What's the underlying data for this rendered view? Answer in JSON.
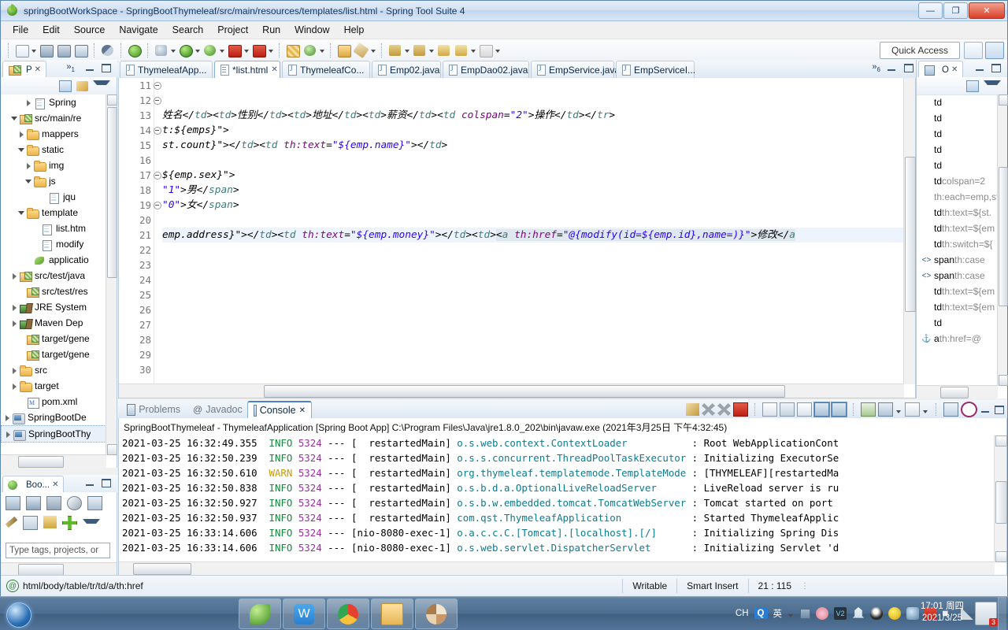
{
  "window": {
    "title": "springBootWorkSpace - SpringBootThymeleaf/src/main/resources/templates/list.html - Spring Tool Suite 4",
    "minimize": "—",
    "maximize": "❐",
    "close": "✕"
  },
  "menubar": [
    "File",
    "Edit",
    "Source",
    "Navigate",
    "Search",
    "Project",
    "Run",
    "Window",
    "Help"
  ],
  "toolbar": {
    "quick_access": "Quick Access"
  },
  "package_explorer": {
    "tab_label": "P",
    "tab_close": "✕",
    "chevron": "»",
    "chevron_count": "1",
    "items": [
      {
        "label": "Spring",
        "indent": 3,
        "arrow": "closed",
        "icon": "jar-icon"
      },
      {
        "label": "src/main/re",
        "indent": 1,
        "arrow": "open",
        "icon": "package-icon"
      },
      {
        "label": "mappers",
        "indent": 2,
        "arrow": "closed",
        "icon": "folder-icon"
      },
      {
        "label": "static",
        "indent": 2,
        "arrow": "open",
        "icon": "folder-icon"
      },
      {
        "label": "img",
        "indent": 3,
        "arrow": "closed",
        "icon": "folder-icon"
      },
      {
        "label": "js",
        "indent": 3,
        "arrow": "open",
        "icon": "folder-icon"
      },
      {
        "label": "jqu",
        "indent": 5,
        "arrow": "none",
        "icon": "js-file-icon"
      },
      {
        "label": "template",
        "indent": 2,
        "arrow": "open",
        "icon": "folder-icon"
      },
      {
        "label": "list.htm",
        "indent": 4,
        "arrow": "none",
        "icon": "html-file-icon"
      },
      {
        "label": "modify",
        "indent": 4,
        "arrow": "none",
        "icon": "html-file-icon"
      },
      {
        "label": "applicatio",
        "indent": 3,
        "arrow": "none",
        "icon": "leaf-icon"
      },
      {
        "label": "src/test/java",
        "indent": 1,
        "arrow": "closed",
        "icon": "package-icon"
      },
      {
        "label": "src/test/res",
        "indent": 2,
        "arrow": "none",
        "icon": "package-icon"
      },
      {
        "label": "JRE System",
        "indent": 1,
        "arrow": "closed",
        "icon": "library-icon"
      },
      {
        "label": "Maven Dep",
        "indent": 1,
        "arrow": "closed",
        "icon": "library-icon"
      },
      {
        "label": "target/gene",
        "indent": 2,
        "arrow": "none",
        "icon": "package-icon"
      },
      {
        "label": "target/gene",
        "indent": 2,
        "arrow": "none",
        "icon": "package-icon"
      },
      {
        "label": "src",
        "indent": 1,
        "arrow": "closed",
        "icon": "folder-icon"
      },
      {
        "label": "target",
        "indent": 1,
        "arrow": "closed",
        "icon": "folder-icon"
      },
      {
        "label": "pom.xml",
        "indent": 2,
        "arrow": "none",
        "icon": "maven-file-icon"
      },
      {
        "label": "SpringBootDe",
        "indent": 0,
        "arrow": "closed",
        "icon": "project-icon"
      },
      {
        "label": "SpringBootThy",
        "indent": 0,
        "arrow": "closed",
        "icon": "project-icon"
      }
    ]
  },
  "boot_dashboard": {
    "tab_label": "Boo...",
    "tab_close": "✕",
    "search_placeholder": "Type tags, projects, or"
  },
  "editor": {
    "tabs": [
      {
        "label": "ThymeleafApp...",
        "icon": "java-file-icon",
        "selected": false,
        "dirty": false
      },
      {
        "label": "*list.html",
        "icon": "html-file-icon",
        "selected": true,
        "dirty": true,
        "close": "✕"
      },
      {
        "label": "ThymeleafCo...",
        "icon": "java-file-icon",
        "selected": false,
        "dirty": false
      },
      {
        "label": "Emp02.java",
        "icon": "java-file-icon",
        "selected": false,
        "dirty": false
      },
      {
        "label": "EmpDao02.java",
        "icon": "java-file-icon",
        "selected": false,
        "dirty": false
      },
      {
        "label": "EmpService.java",
        "icon": "java-file-icon",
        "selected": false,
        "dirty": false
      },
      {
        "label": "EmpServiceI...",
        "icon": "java-file-icon",
        "selected": false,
        "dirty": false
      }
    ],
    "overflow_chevron": "»",
    "overflow_count": "6",
    "lines": [
      {
        "num": "11",
        "fold": true,
        "text": "",
        "current": false
      },
      {
        "num": "12",
        "fold": true,
        "text": "",
        "current": false
      },
      {
        "num": "13",
        "fold": false,
        "text": "姓名</td><td>性别</td><td>地址</td><td>薪资</td><td colspan=\"2\">操作</td></tr>",
        "current": false
      },
      {
        "num": "14",
        "fold": true,
        "text": "t:${emps}\">",
        "current": false
      },
      {
        "num": "15",
        "fold": false,
        "text": "st.count}\"></td><td th:text=\"${emp.name}\"></td>",
        "current": false
      },
      {
        "num": "16",
        "fold": false,
        "text": "",
        "current": false
      },
      {
        "num": "17",
        "fold": true,
        "text": "${emp.sex}\">",
        "current": false
      },
      {
        "num": "18",
        "fold": false,
        "text": "\"1\">男</span>",
        "current": false
      },
      {
        "num": "19",
        "fold": true,
        "text": "\"0\">女</span>",
        "current": false
      },
      {
        "num": "20",
        "fold": false,
        "text": "",
        "current": false
      },
      {
        "num": "21",
        "fold": false,
        "text": "emp.address}\"></td><td th:text=\"${emp.money}\"></td><td><a th:href=\"@{modify(id=${emp.id},name=)}\">修改</a",
        "current": true
      },
      {
        "num": "22",
        "fold": false,
        "text": "",
        "current": false
      },
      {
        "num": "23",
        "fold": false,
        "text": "",
        "current": false
      },
      {
        "num": "24",
        "fold": false,
        "text": "",
        "current": false
      },
      {
        "num": "25",
        "fold": false,
        "text": "",
        "current": false
      },
      {
        "num": "26",
        "fold": false,
        "text": "",
        "current": false
      },
      {
        "num": "27",
        "fold": false,
        "text": "",
        "current": false
      },
      {
        "num": "28",
        "fold": false,
        "text": "",
        "current": false
      },
      {
        "num": "29",
        "fold": false,
        "text": "",
        "current": false
      },
      {
        "num": "30",
        "fold": false,
        "text": "",
        "current": false
      }
    ]
  },
  "outline": {
    "tab_label": "O",
    "tab_close": "✕",
    "items": [
      {
        "element": "td",
        "attr": ""
      },
      {
        "element": "td",
        "attr": ""
      },
      {
        "element": "td",
        "attr": ""
      },
      {
        "element": "td",
        "attr": ""
      },
      {
        "element": "td",
        "attr": ""
      },
      {
        "element": "td",
        "attr": "colspan=2"
      },
      {
        "element": "",
        "attr": "th:each=emp,st"
      },
      {
        "element": "td",
        "attr": "th:text=${st."
      },
      {
        "element": "td",
        "attr": "th:text=${em"
      },
      {
        "element": "td",
        "attr": "th:switch=${"
      },
      {
        "element": "span",
        "attr": "th:case",
        "icon": "angle-icon"
      },
      {
        "element": "span",
        "attr": "th:case",
        "icon": "angle-icon"
      },
      {
        "element": "td",
        "attr": "th:text=${em"
      },
      {
        "element": "td",
        "attr": "th:text=${em"
      },
      {
        "element": "td",
        "attr": ""
      },
      {
        "element": "a",
        "attr": "th:href=@",
        "icon": "anchor-icon"
      }
    ]
  },
  "console": {
    "tabs": [
      {
        "label": "Problems",
        "icon": "problems-icon",
        "selected": false
      },
      {
        "label": "Javadoc",
        "icon": "javadoc-icon",
        "selected": false
      },
      {
        "label": "Console",
        "icon": "console-icon",
        "selected": true,
        "close": "✕"
      }
    ],
    "header": "SpringBootThymeleaf - ThymeleafApplication [Spring Boot App] C:\\Program Files\\Java\\jre1.8.0_202\\bin\\javaw.exe (2021年3月25日 下午4:32:45)",
    "log": [
      {
        "date": "2021-03-25 16:32:49.355",
        "level": "INFO",
        "pid": "5324",
        "dash": "---",
        "thread": "[  restartedMain]",
        "cls": "o.s.web.context.ContextLoader",
        "msg": ": Root WebApplicationCont"
      },
      {
        "date": "2021-03-25 16:32:50.239",
        "level": "INFO",
        "pid": "5324",
        "dash": "---",
        "thread": "[  restartedMain]",
        "cls": "o.s.s.concurrent.ThreadPoolTaskExecutor",
        "msg": ": Initializing ExecutorSe"
      },
      {
        "date": "2021-03-25 16:32:50.610",
        "level": "WARN",
        "pid": "5324",
        "dash": "---",
        "thread": "[  restartedMain]",
        "cls": "org.thymeleaf.templatemode.TemplateMode",
        "msg": ": [THYMELEAF][restartedMa"
      },
      {
        "date": "2021-03-25 16:32:50.838",
        "level": "INFO",
        "pid": "5324",
        "dash": "---",
        "thread": "[  restartedMain]",
        "cls": "o.s.b.d.a.OptionalLiveReloadServer",
        "msg": ": LiveReload server is ru"
      },
      {
        "date": "2021-03-25 16:32:50.927",
        "level": "INFO",
        "pid": "5324",
        "dash": "---",
        "thread": "[  restartedMain]",
        "cls": "o.s.b.w.embedded.tomcat.TomcatWebServer",
        "msg": ": Tomcat started on port"
      },
      {
        "date": "2021-03-25 16:32:50.937",
        "level": "INFO",
        "pid": "5324",
        "dash": "---",
        "thread": "[  restartedMain]",
        "cls": "com.qst.ThymeleafApplication",
        "msg": ": Started ThymeleafApplic"
      },
      {
        "date": "2021-03-25 16:33:14.606",
        "level": "INFO",
        "pid": "5324",
        "dash": "---",
        "thread": "[nio-8080-exec-1]",
        "cls": "o.a.c.c.C.[Tomcat].[localhost].[/]",
        "msg": ": Initializing Spring Dis"
      },
      {
        "date": "2021-03-25 16:33:14.606",
        "level": "INFO",
        "pid": "5324",
        "dash": "---",
        "thread": "[nio-8080-exec-1]",
        "cls": "o.s.web.servlet.DispatcherServlet",
        "msg": ": Initializing Servlet 'd"
      }
    ]
  },
  "status_bar": {
    "path": "html/body/table/tr/td/a/th:href",
    "writable": "Writable",
    "insert_mode": "Smart Insert",
    "position": "21 : 115"
  },
  "taskbar": {
    "apps": [
      {
        "name": "spring-tool-suite",
        "icon": "leaf-icon"
      },
      {
        "name": "wps-writer",
        "icon": "w-icon"
      },
      {
        "name": "google-chrome",
        "icon": "chrome-icon"
      },
      {
        "name": "file-explorer",
        "icon": "folder-icon"
      },
      {
        "name": "misc-app",
        "icon": "pie-icon"
      }
    ],
    "ime": "CH",
    "ime_q": "Q",
    "ime_lang": "英",
    "time": "17:01 周四",
    "date": "2021/3/25",
    "notification_count": "3"
  },
  "colors": {
    "accent": "#4f83bd",
    "title_text": "#15365e",
    "string_literal": "#2a00ff",
    "tag": "#3f7f7f",
    "attribute": "#7f007f",
    "info": "#128a3a",
    "warn": "#c79a00",
    "class_name": "#0d7b8f",
    "pid": "#9b30a0"
  }
}
